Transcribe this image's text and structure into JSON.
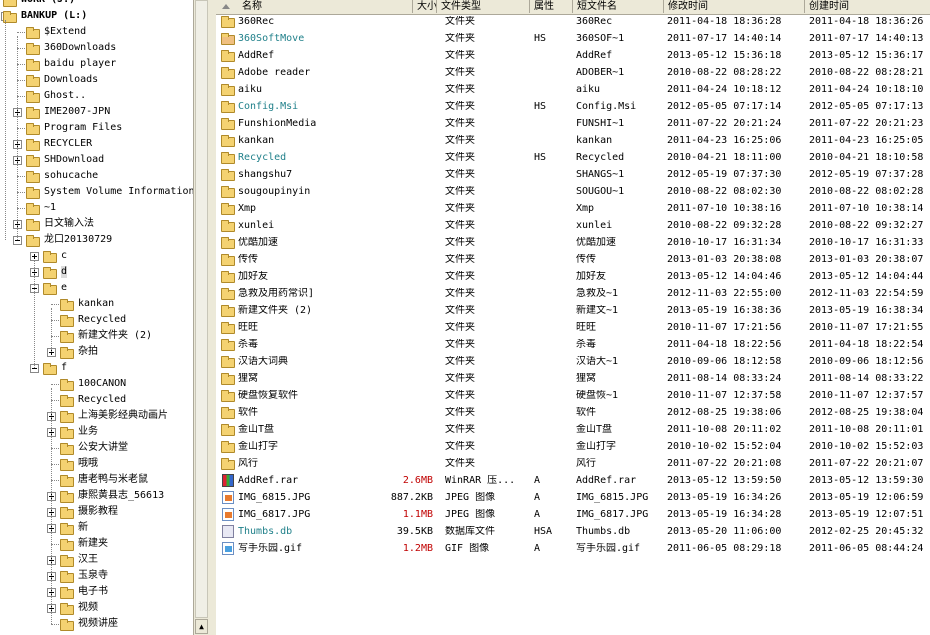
{
  "tree": [
    {
      "label": "WORK (J:)",
      "indent": 0,
      "bold": true,
      "expander": "none"
    },
    {
      "label": "BANKUP (L:)",
      "indent": 0,
      "bold": true,
      "expander": "minus"
    },
    {
      "label": "$Extend",
      "indent": 1,
      "expander": "none"
    },
    {
      "label": "360Downloads",
      "indent": 1,
      "expander": "none"
    },
    {
      "label": "baidu player",
      "indent": 1,
      "expander": "none"
    },
    {
      "label": "Downloads",
      "indent": 1,
      "expander": "none"
    },
    {
      "label": "Ghost..",
      "indent": 1,
      "expander": "none"
    },
    {
      "label": "IME2007-JPN",
      "indent": 1,
      "expander": "plus"
    },
    {
      "label": "Program Files",
      "indent": 1,
      "expander": "none"
    },
    {
      "label": "RECYCLER",
      "indent": 1,
      "expander": "plus"
    },
    {
      "label": "SHDownload",
      "indent": 1,
      "expander": "plus"
    },
    {
      "label": "sohucache",
      "indent": 1,
      "expander": "none"
    },
    {
      "label": "System Volume Information",
      "indent": 1,
      "expander": "none"
    },
    {
      "label": "~1",
      "indent": 1,
      "expander": "none"
    },
    {
      "label": "日文输入法",
      "indent": 1,
      "expander": "plus"
    },
    {
      "label": "龙口20130729",
      "indent": 1,
      "expander": "minus"
    },
    {
      "label": "c",
      "indent": 2,
      "expander": "plus"
    },
    {
      "label": "d",
      "indent": 2,
      "expander": "plus",
      "selected": true
    },
    {
      "label": "e",
      "indent": 2,
      "expander": "minus"
    },
    {
      "label": "kankan",
      "indent": 3,
      "expander": "none"
    },
    {
      "label": "Recycled",
      "indent": 3,
      "expander": "none"
    },
    {
      "label": "新建文件夹 (2)",
      "indent": 3,
      "expander": "none"
    },
    {
      "label": "杂拍",
      "indent": 3,
      "expander": "plus"
    },
    {
      "label": "f",
      "indent": 2,
      "expander": "minus"
    },
    {
      "label": "100CANON",
      "indent": 3,
      "expander": "none"
    },
    {
      "label": "Recycled",
      "indent": 3,
      "expander": "none"
    },
    {
      "label": "上海美影经典动画片",
      "indent": 3,
      "expander": "plus"
    },
    {
      "label": "业务",
      "indent": 3,
      "expander": "plus"
    },
    {
      "label": "公安大讲堂",
      "indent": 3,
      "expander": "none"
    },
    {
      "label": "哦哦",
      "indent": 3,
      "expander": "none"
    },
    {
      "label": "唐老鸭与米老鼠",
      "indent": 3,
      "expander": "none"
    },
    {
      "label": "康熙黄县志_56613",
      "indent": 3,
      "expander": "plus"
    },
    {
      "label": "摄影教程",
      "indent": 3,
      "expander": "plus"
    },
    {
      "label": "新",
      "indent": 3,
      "expander": "plus"
    },
    {
      "label": "新建夹",
      "indent": 3,
      "expander": "none"
    },
    {
      "label": "汉王",
      "indent": 3,
      "expander": "plus"
    },
    {
      "label": "玉泉寺",
      "indent": 3,
      "expander": "plus"
    },
    {
      "label": "电子书",
      "indent": 3,
      "expander": "plus"
    },
    {
      "label": "视频",
      "indent": 3,
      "expander": "plus"
    },
    {
      "label": "视频讲座",
      "indent": 3,
      "expander": "none"
    }
  ],
  "columns": {
    "name": "名称",
    "size": "大小",
    "type": "文件类型",
    "attr": "属性",
    "short": "短文件名",
    "modified": "修改时间",
    "created": "创建时间"
  },
  "files": [
    {
      "name": "360Rec",
      "size": "",
      "type": "文件夹",
      "attr": "",
      "short": "360Rec",
      "modified": "2011-04-18 18:36:28",
      "created": "2011-04-18 18:36:26",
      "icon": "folder"
    },
    {
      "name": "360SoftMove",
      "size": "",
      "type": "文件夹",
      "attr": "HS",
      "short": "360SOF~1",
      "modified": "2011-07-17 14:40:14",
      "created": "2011-07-17 14:40:13",
      "icon": "special",
      "teal": true
    },
    {
      "name": "AddRef",
      "size": "",
      "type": "文件夹",
      "attr": "",
      "short": "AddRef",
      "modified": "2013-05-12 15:36:18",
      "created": "2013-05-12 15:36:17",
      "icon": "folder"
    },
    {
      "name": "Adobe reader",
      "size": "",
      "type": "文件夹",
      "attr": "",
      "short": "ADOBER~1",
      "modified": "2010-08-22 08:28:22",
      "created": "2010-08-22 08:28:21",
      "icon": "folder"
    },
    {
      "name": "aiku",
      "size": "",
      "type": "文件夹",
      "attr": "",
      "short": "aiku",
      "modified": "2011-04-24 10:18:12",
      "created": "2011-04-24 10:18:10",
      "icon": "folder"
    },
    {
      "name": "Config.Msi",
      "size": "",
      "type": "文件夹",
      "attr": "HS",
      "short": "Config.Msi",
      "modified": "2012-05-05 07:17:14",
      "created": "2012-05-05 07:17:13",
      "icon": "folder",
      "teal": true
    },
    {
      "name": "FunshionMedia",
      "size": "",
      "type": "文件夹",
      "attr": "",
      "short": "FUNSHI~1",
      "modified": "2011-07-22 20:21:24",
      "created": "2011-07-22 20:21:23",
      "icon": "folder"
    },
    {
      "name": "kankan",
      "size": "",
      "type": "文件夹",
      "attr": "",
      "short": "kankan",
      "modified": "2011-04-23 16:25:06",
      "created": "2011-04-23 16:25:05",
      "icon": "folder"
    },
    {
      "name": "Recycled",
      "size": "",
      "type": "文件夹",
      "attr": "HS",
      "short": "Recycled",
      "modified": "2010-04-21 18:11:00",
      "created": "2010-04-21 18:10:58",
      "icon": "recycle",
      "teal": true
    },
    {
      "name": "shangshu7",
      "size": "",
      "type": "文件夹",
      "attr": "",
      "short": "SHANGS~1",
      "modified": "2012-05-19 07:37:30",
      "created": "2012-05-19 07:37:28",
      "icon": "folder"
    },
    {
      "name": "sougoupinyin",
      "size": "",
      "type": "文件夹",
      "attr": "",
      "short": "SOUGOU~1",
      "modified": "2010-08-22 08:02:30",
      "created": "2010-08-22 08:02:28",
      "icon": "folder"
    },
    {
      "name": "Xmp",
      "size": "",
      "type": "文件夹",
      "attr": "",
      "short": "Xmp",
      "modified": "2011-07-10 10:38:16",
      "created": "2011-07-10 10:38:14",
      "icon": "folder"
    },
    {
      "name": "xunlei",
      "size": "",
      "type": "文件夹",
      "attr": "",
      "short": "xunlei",
      "modified": "2010-08-22 09:32:28",
      "created": "2010-08-22 09:32:27",
      "icon": "folder"
    },
    {
      "name": "优酷加速",
      "size": "",
      "type": "文件夹",
      "attr": "",
      "short": "优酷加速",
      "modified": "2010-10-17 16:31:34",
      "created": "2010-10-17 16:31:33",
      "icon": "folder"
    },
    {
      "name": "传传",
      "size": "",
      "type": "文件夹",
      "attr": "",
      "short": "传传",
      "modified": "2013-01-03 20:38:08",
      "created": "2013-01-03 20:38:07",
      "icon": "folder"
    },
    {
      "name": "加好友",
      "size": "",
      "type": "文件夹",
      "attr": "",
      "short": "加好友",
      "modified": "2013-05-12 14:04:46",
      "created": "2013-05-12 14:04:44",
      "icon": "folder"
    },
    {
      "name": "急救及用药常识]",
      "size": "",
      "type": "文件夹",
      "attr": "",
      "short": "急救及~1",
      "modified": "2012-11-03 22:55:00",
      "created": "2012-11-03 22:54:59",
      "icon": "folder"
    },
    {
      "name": "新建文件夹 (2)",
      "size": "",
      "type": "文件夹",
      "attr": "",
      "short": "新建文~1",
      "modified": "2013-05-19 16:38:36",
      "created": "2013-05-19 16:38:34",
      "icon": "folder"
    },
    {
      "name": "旺旺",
      "size": "",
      "type": "文件夹",
      "attr": "",
      "short": "旺旺",
      "modified": "2010-11-07 17:21:56",
      "created": "2010-11-07 17:21:55",
      "icon": "folder"
    },
    {
      "name": "杀毒",
      "size": "",
      "type": "文件夹",
      "attr": "",
      "short": "杀毒",
      "modified": "2011-04-18 18:22:56",
      "created": "2011-04-18 18:22:54",
      "icon": "folder"
    },
    {
      "name": "汉语大词典",
      "size": "",
      "type": "文件夹",
      "attr": "",
      "short": "汉语大~1",
      "modified": "2010-09-06 18:12:58",
      "created": "2010-09-06 18:12:56",
      "icon": "folder"
    },
    {
      "name": "狸窝",
      "size": "",
      "type": "文件夹",
      "attr": "",
      "short": "狸窝",
      "modified": "2011-08-14 08:33:24",
      "created": "2011-08-14 08:33:22",
      "icon": "folder"
    },
    {
      "name": "硬盘恢复软件",
      "size": "",
      "type": "文件夹",
      "attr": "",
      "short": "硬盘恢~1",
      "modified": "2010-11-07 12:37:58",
      "created": "2010-11-07 12:37:57",
      "icon": "folder"
    },
    {
      "name": "软件",
      "size": "",
      "type": "文件夹",
      "attr": "",
      "short": "软件",
      "modified": "2012-08-25 19:38:06",
      "created": "2012-08-25 19:38:04",
      "icon": "folder"
    },
    {
      "name": "金山T盘",
      "size": "",
      "type": "文件夹",
      "attr": "",
      "short": "金山T盘",
      "modified": "2011-10-08 20:11:02",
      "created": "2011-10-08 20:11:01",
      "icon": "folder"
    },
    {
      "name": "金山打字",
      "size": "",
      "type": "文件夹",
      "attr": "",
      "short": "金山打字",
      "modified": "2010-10-02 15:52:04",
      "created": "2010-10-02 15:52:03",
      "icon": "folder"
    },
    {
      "name": "风行",
      "size": "",
      "type": "文件夹",
      "attr": "",
      "short": "风行",
      "modified": "2011-07-22 20:21:08",
      "created": "2011-07-22 20:21:07",
      "icon": "folder"
    },
    {
      "name": "AddRef.rar",
      "size": "2.6MB",
      "sizeRed": true,
      "type": "WinRAR 压...",
      "attr": "A",
      "short": "AddRef.rar",
      "modified": "2013-05-12 13:59:50",
      "created": "2013-05-12 13:59:30",
      "icon": "rar"
    },
    {
      "name": "IMG_6815.JPG",
      "size": "887.2KB",
      "type": "JPEG 图像",
      "attr": "A",
      "short": "IMG_6815.JPG",
      "modified": "2013-05-19 16:34:26",
      "created": "2013-05-19 12:06:59",
      "icon": "jpg"
    },
    {
      "name": "IMG_6817.JPG",
      "size": "1.1MB",
      "sizeRed": true,
      "type": "JPEG 图像",
      "attr": "A",
      "short": "IMG_6817.JPG",
      "modified": "2013-05-19 16:34:28",
      "created": "2013-05-19 12:07:51",
      "icon": "jpg"
    },
    {
      "name": "Thumbs.db",
      "size": "39.5KB",
      "type": "数据库文件",
      "attr": "HSA",
      "short": "Thumbs.db",
      "modified": "2013-05-20 11:06:00",
      "created": "2012-02-25 20:45:32",
      "icon": "db",
      "teal": true
    },
    {
      "name": "写手乐园.gif",
      "size": "1.2MB",
      "sizeRed": true,
      "type": "GIF 图像",
      "attr": "A",
      "short": "写手乐园.gif",
      "modified": "2011-06-05 08:29:18",
      "created": "2011-06-05 08:44:24",
      "icon": "gif"
    }
  ]
}
